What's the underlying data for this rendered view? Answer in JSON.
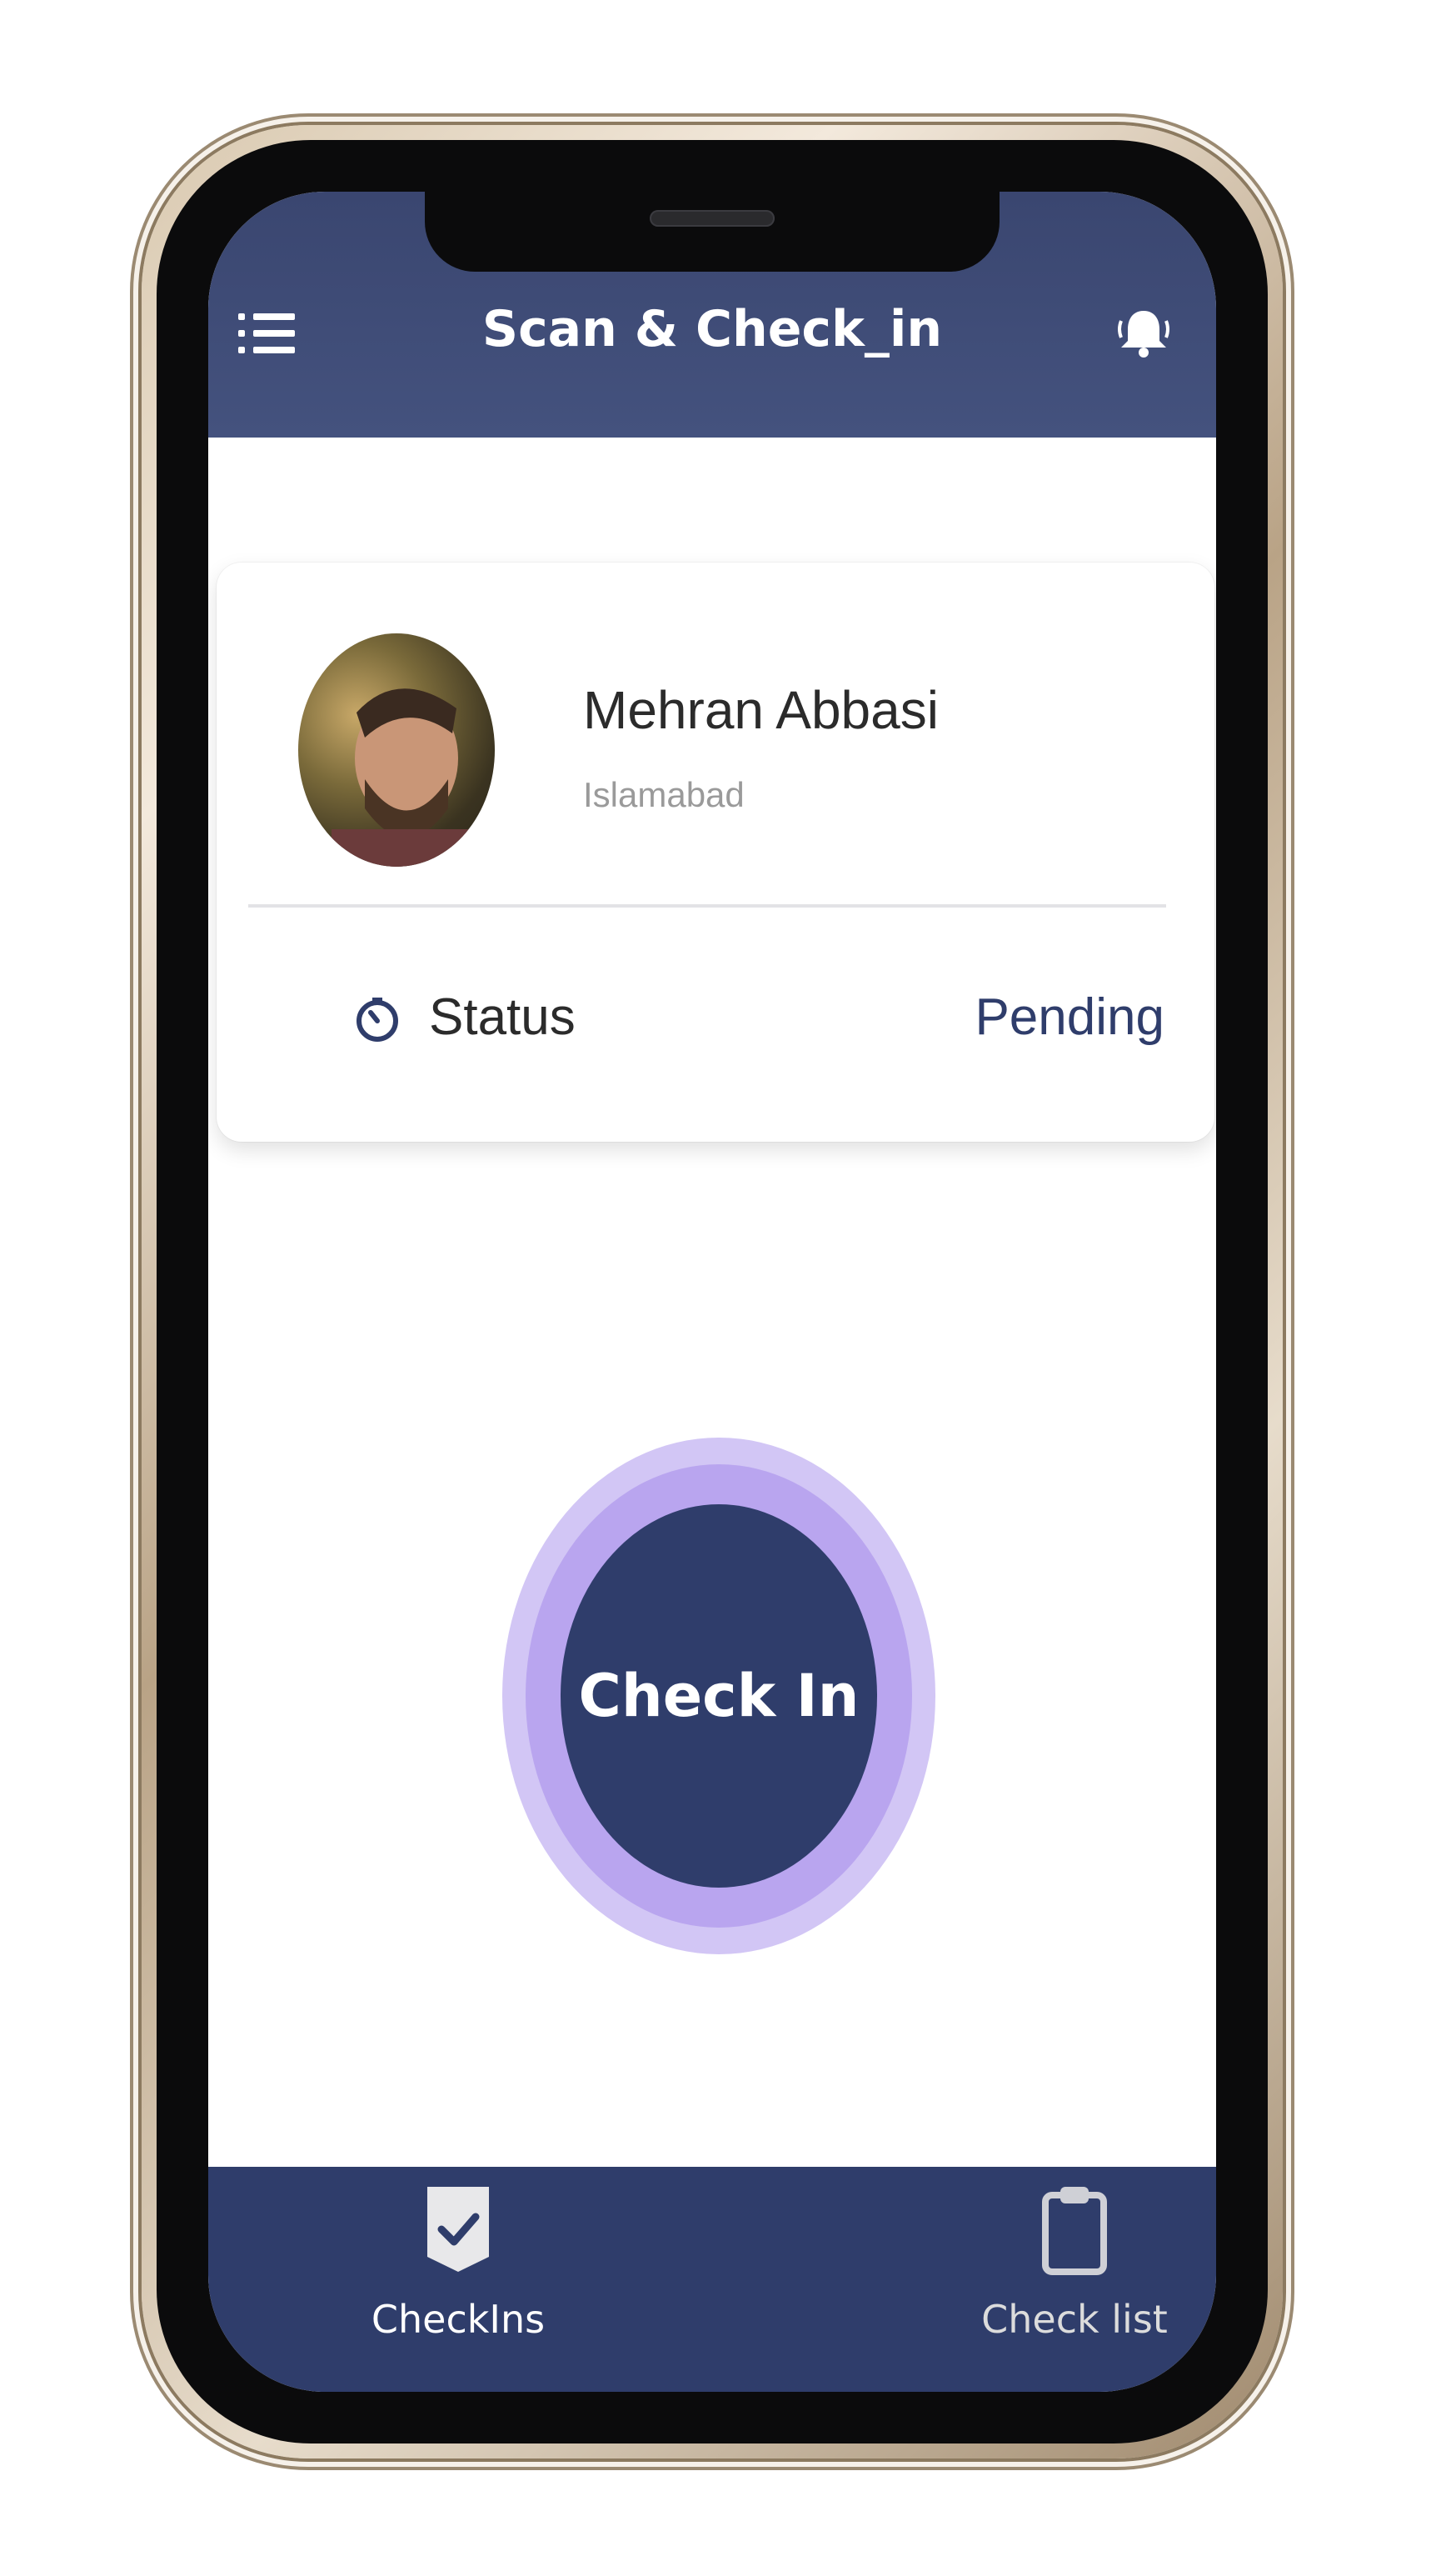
{
  "header": {
    "title": "Scan & Check_in",
    "menu_icon": "menu-icon",
    "bell_icon": "bell-icon"
  },
  "profile": {
    "name": "Mehran Abbasi",
    "city": "Islamabad",
    "status_label": "Status",
    "status_value": "Pending",
    "status_icon": "clock-icon"
  },
  "checkin": {
    "label": "Check In"
  },
  "bottom_nav": {
    "items": [
      {
        "label": "CheckIns",
        "icon": "shield-check-icon"
      },
      {
        "label": "Check list",
        "icon": "clipboard-icon"
      }
    ]
  },
  "colors": {
    "primary": "#2f3d6b",
    "header": "#3a4670",
    "ring_outer": "#d2c6f5",
    "ring_mid": "#b9a5ef"
  }
}
